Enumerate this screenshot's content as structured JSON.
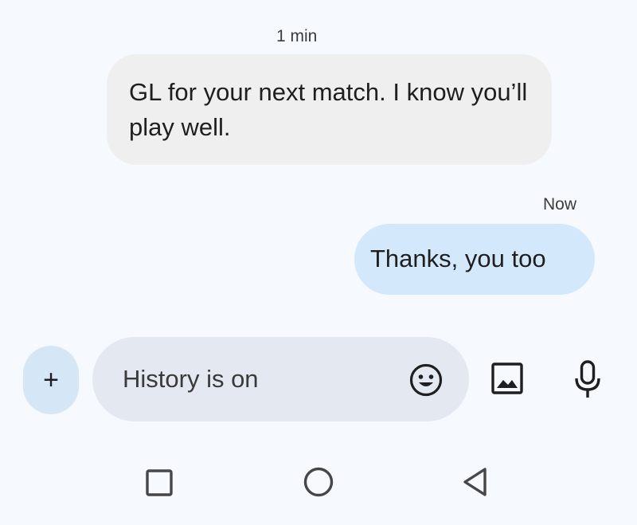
{
  "conversation": {
    "incoming": {
      "timestamp": "1 min",
      "text": "GL for your next match. I know you’ll play well."
    },
    "outgoing": {
      "timestamp": "Now",
      "text": "Thanks, you too"
    }
  },
  "composer": {
    "add_label": "+",
    "placeholder": "History is on",
    "value": "",
    "icons": [
      "emoji-icon",
      "image-icon",
      "microphone-icon"
    ]
  },
  "navbar": {
    "icons": [
      "recent-apps-icon",
      "home-icon",
      "back-icon"
    ]
  },
  "colors": {
    "background": "#f6f9fd",
    "incoming_bubble": "#efefef",
    "outgoing_bubble": "#d3e9fb",
    "compose_field": "#e4e9f1",
    "add_button": "#d5e6f6"
  }
}
